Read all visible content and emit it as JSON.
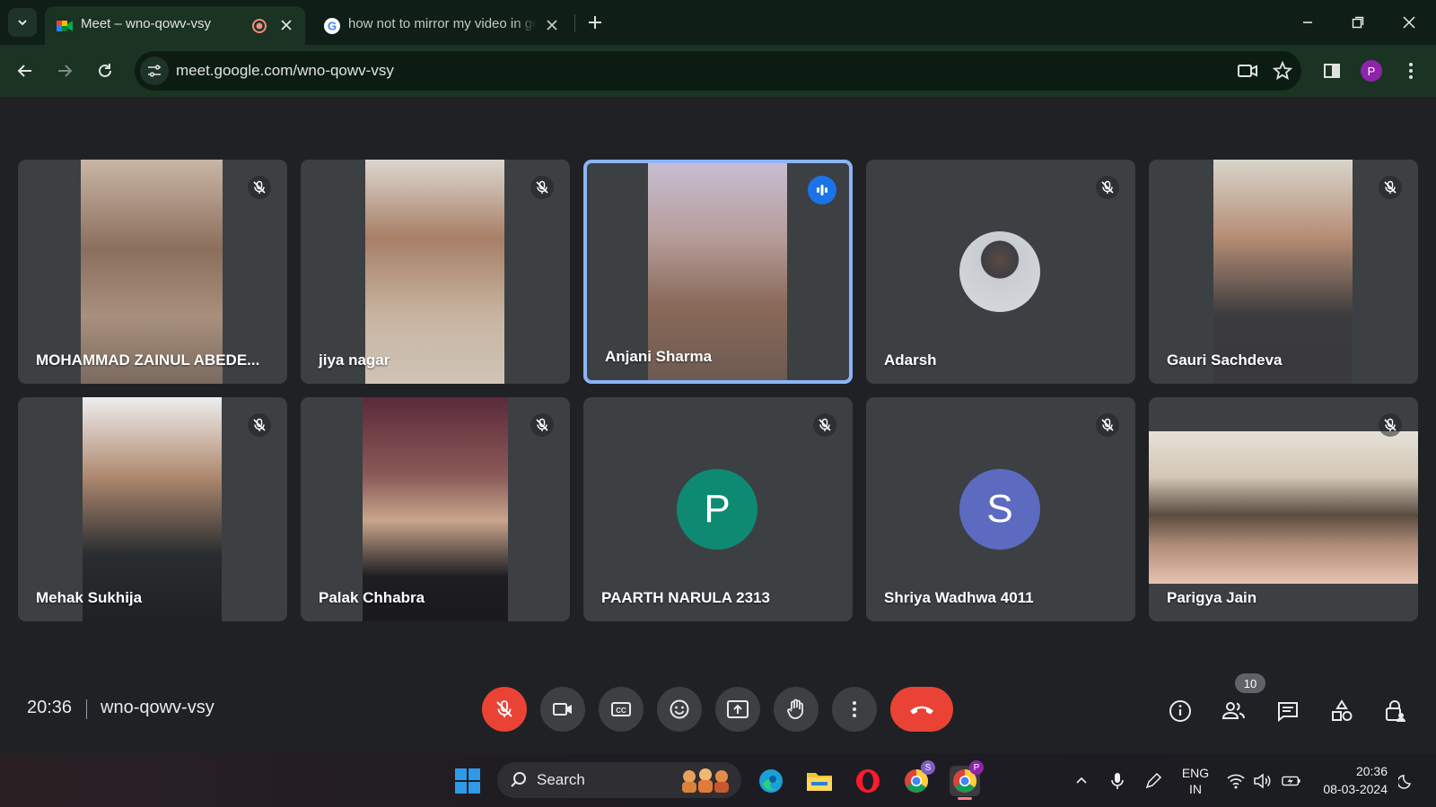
{
  "browser": {
    "tabs": [
      {
        "title": "Meet – wno-qowv-vsy",
        "active": true
      },
      {
        "title": "how not to mirror my video in google meet",
        "active": false
      }
    ],
    "url": "meet.google.com/wno-qowv-vsy",
    "profile_initial": "P"
  },
  "meeting": {
    "time": "20:36",
    "code": "wno-qowv-vsy",
    "participant_count": "10"
  },
  "participants": [
    {
      "name": "MOHAMMAD ZAINUL ABEDE...",
      "video": true,
      "muted": true
    },
    {
      "name": "jiya nagar",
      "video": true,
      "muted": true
    },
    {
      "name": "Anjani Sharma",
      "video": true,
      "muted": false,
      "speaking": true
    },
    {
      "name": "Adarsh",
      "video": false,
      "photo_avatar": true,
      "muted": true
    },
    {
      "name": "Gauri Sachdeva",
      "video": true,
      "muted": true
    },
    {
      "name": "Mehak Sukhija",
      "video": true,
      "muted": true
    },
    {
      "name": "Palak Chhabra",
      "video": true,
      "muted": true
    },
    {
      "name": "PAARTH NARULA 2313",
      "video": false,
      "initial": "P",
      "avatar_color": "#0e8a73",
      "muted": true
    },
    {
      "name": "Shriya Wadhwa 4011",
      "video": false,
      "initial": "S",
      "avatar_color": "#5c6bc0",
      "muted": true
    },
    {
      "name": "Parigya Jain",
      "video": true,
      "muted": true
    }
  ],
  "taskbar": {
    "search_label": "Search",
    "language": "ENG",
    "region": "IN",
    "clock_time": "20:36",
    "clock_date": "08-03-2024",
    "chrome_badges": [
      "S",
      "P"
    ]
  },
  "colors": {
    "meet_bg": "#202124",
    "tile_bg": "#3c4043",
    "speaking_border": "#8ab4f8",
    "end_call": "#ea4335",
    "browser_frame": "#1b3323"
  }
}
